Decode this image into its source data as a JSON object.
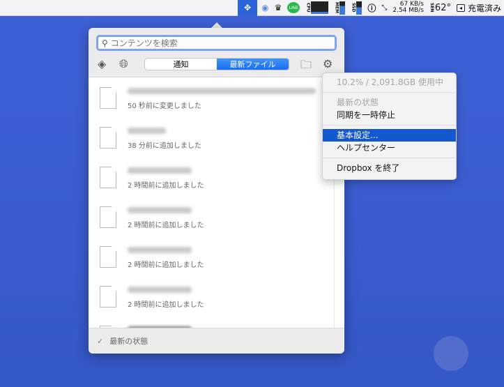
{
  "menubar": {
    "dropbox_icon": "dropbox-icon",
    "cpu_label": "CPU",
    "mem_label": "MEM",
    "ssd_label": "SSD",
    "net_up": "67 KB/s",
    "net_down": "2.54 MB/s",
    "sen_label": "SEN",
    "temperature": "62°",
    "battery_status": "充電済み"
  },
  "popup": {
    "search": {
      "placeholder": "コンテンツを検索",
      "value": ""
    },
    "tabs": [
      {
        "label": "通知",
        "active": false
      },
      {
        "label": "最新ファイル",
        "active": true
      }
    ],
    "files": [
      {
        "status": "50 秒前に変更しました"
      },
      {
        "status": "38 分前に追加しました"
      },
      {
        "status": "2 時間前に追加しました"
      },
      {
        "status": "2 時間前に追加しました"
      },
      {
        "status": "2 時間前に追加しました"
      },
      {
        "status": "2 時間前に追加しました"
      }
    ],
    "footer_status": "最新の状態"
  },
  "menu": {
    "usage": "10.2% / 2,091.8GB 使用中",
    "sync_status": "最新の状態",
    "pause_sync": "同期を一時停止",
    "preferences": "基本設定...",
    "help_center": "ヘルプセンター",
    "quit": "Dropbox を終了"
  },
  "colors": {
    "accent": "#1a6ff0",
    "menu_selected": "#1458d0",
    "desktop": "#3d61d6"
  }
}
